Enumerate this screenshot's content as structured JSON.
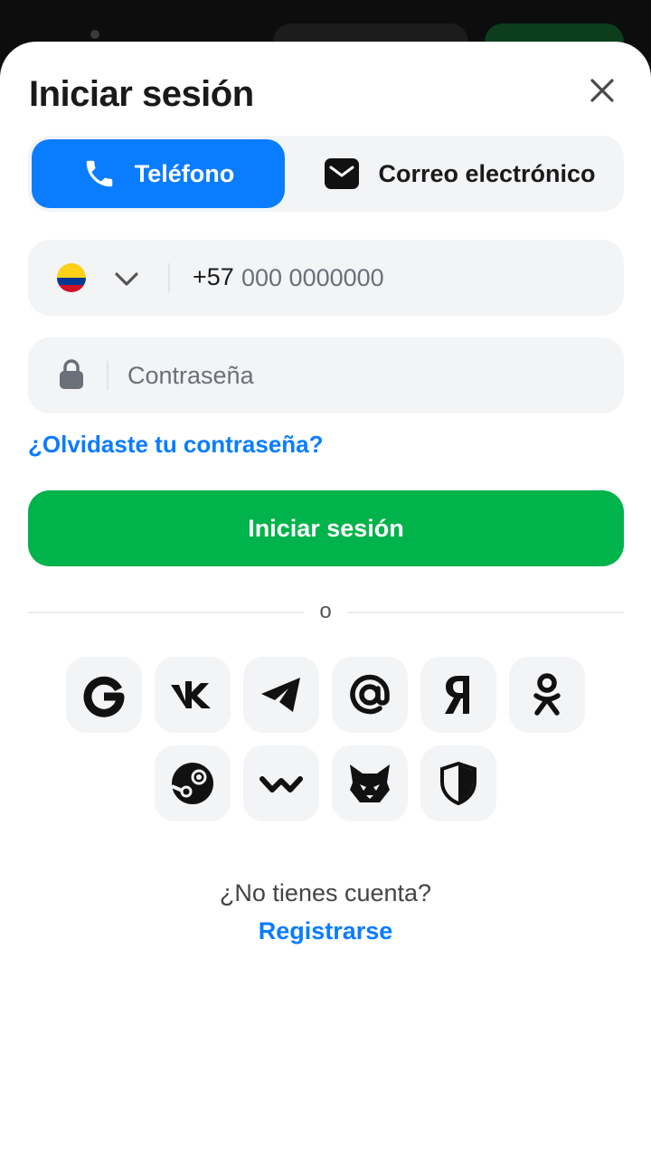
{
  "header": {
    "title": "Iniciar sesión"
  },
  "tabs": [
    {
      "label": "Teléfono",
      "icon": "phone-icon",
      "active": true
    },
    {
      "label": "Correo electrónico",
      "icon": "mail-icon",
      "active": false
    }
  ],
  "phone": {
    "country_flag": "colombia-flag-icon",
    "prefix": "+57",
    "placeholder": "000 0000000"
  },
  "password": {
    "placeholder": "Contraseña"
  },
  "forgot_link": "¿Olvidaste tu contraseña?",
  "login_button": "Iniciar sesión",
  "divider": "o",
  "social_buttons": [
    "google-icon",
    "vk-icon",
    "telegram-icon",
    "mail-ru-icon",
    "yandex-icon",
    "odnoklassniki-icon",
    "steam-icon",
    "walletconnect-icon",
    "metamask-icon",
    "shield-icon"
  ],
  "footer": {
    "prompt": "¿No tienes cuenta?",
    "register_link": "Registrarse"
  },
  "colors": {
    "accent_blue": "#0a7cff",
    "primary_green": "#00b34a",
    "field_bg": "#f3f4f6"
  }
}
